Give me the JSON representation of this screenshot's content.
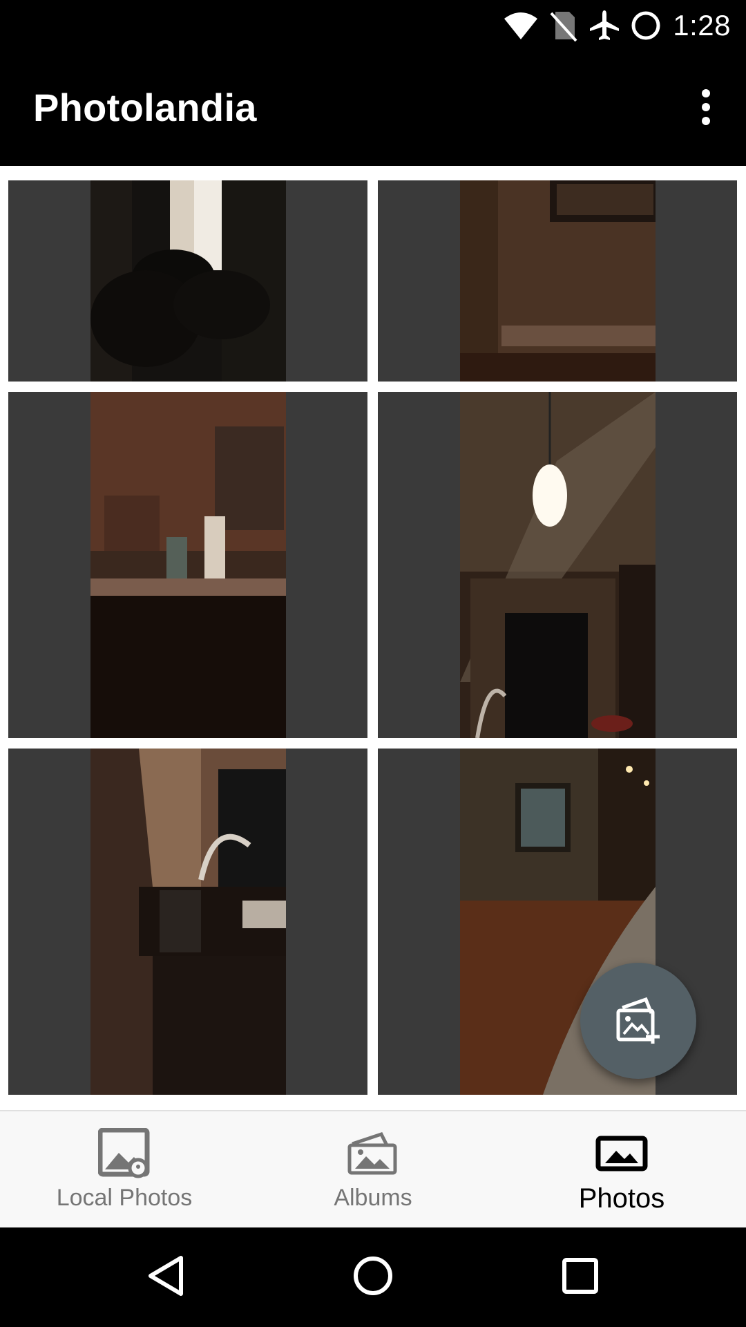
{
  "status_bar": {
    "time": "1:28",
    "icons": [
      "wifi-icon",
      "no-sim-icon",
      "airplane-mode-icon",
      "battery-icon"
    ]
  },
  "app_bar": {
    "title": "Photolandia",
    "overflow_icon": "more-vert-icon"
  },
  "photos": [
    {
      "name": "photo-1",
      "description_icon": "photo-plant-lamp"
    },
    {
      "name": "photo-2",
      "description_icon": "photo-wall-corner"
    },
    {
      "name": "photo-3",
      "description_icon": "photo-kitchen-counter"
    },
    {
      "name": "photo-4",
      "description_icon": "photo-pendant-light"
    },
    {
      "name": "photo-5",
      "description_icon": "photo-sink-faucet"
    },
    {
      "name": "photo-6",
      "description_icon": "photo-hallway"
    }
  ],
  "fab": {
    "icon": "add-photo-icon"
  },
  "bottom_nav": {
    "items": [
      {
        "label": "Local Photos",
        "icon": "local-photos-icon",
        "active": false
      },
      {
        "label": "Albums",
        "icon": "albums-icon",
        "active": false
      },
      {
        "label": "Photos",
        "icon": "photos-icon",
        "active": true
      }
    ]
  },
  "system_nav": {
    "buttons": [
      "back-icon",
      "home-icon",
      "recents-icon"
    ]
  },
  "colors": {
    "app_bar_bg": "#000000",
    "tile_bg": "#3a3a3a",
    "fab_bg": "#546066",
    "nav_inactive": "#757575",
    "nav_active": "#000000"
  }
}
